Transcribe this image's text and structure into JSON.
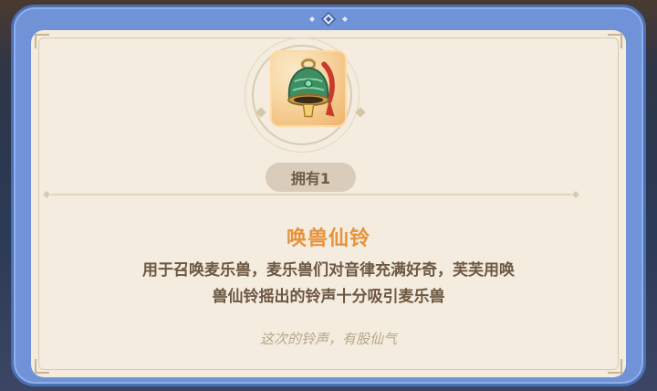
{
  "item": {
    "icon": "bell-icon",
    "owned_label": "拥有1",
    "name": "唤兽仙铃",
    "description_line1": "用于召唤麦乐兽，麦乐兽们对音律充满好奇，芙芙用唤",
    "description_line2": "兽仙铃摇出的铃声十分吸引麦乐兽",
    "flavor_text": "这次的铃声，有股仙气"
  },
  "colors": {
    "frame": "#6f93d6",
    "panel": "#f3ecdf",
    "title": "#e7923b",
    "description": "#6d5741",
    "flavor": "#b9a588",
    "card": "#f0a04a"
  }
}
